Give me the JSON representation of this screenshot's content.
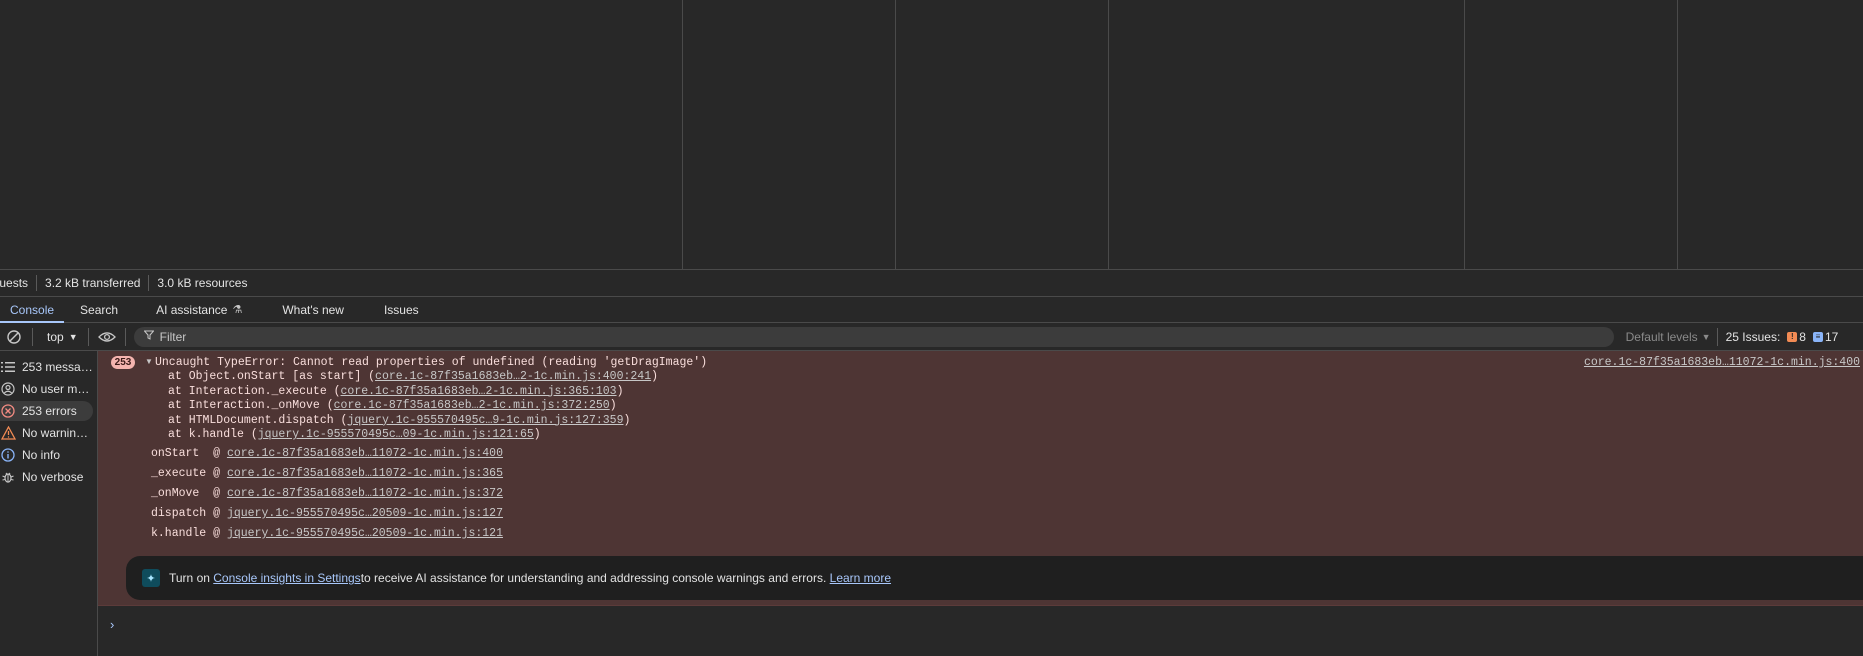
{
  "network_status": {
    "requests": "equests",
    "transferred": "3.2 kB transferred",
    "resources": "3.0 kB resources"
  },
  "drawer_tabs": [
    {
      "label": "Console"
    },
    {
      "label": "Search"
    },
    {
      "label": "AI assistance"
    },
    {
      "label": "What's new"
    },
    {
      "label": "Issues"
    }
  ],
  "toolbar": {
    "context": "top",
    "filter_placeholder": "Filter",
    "levels": "Default levels",
    "issues_label": "25 Issues:",
    "issues_warnings": "8",
    "issues_info": "17"
  },
  "sidebar": {
    "items": [
      {
        "label": "253 messa…"
      },
      {
        "label": "No user m…"
      },
      {
        "label": "253 errors"
      },
      {
        "label": "No warnin…"
      },
      {
        "label": "No info"
      },
      {
        "label": "No verbose"
      }
    ]
  },
  "error": {
    "count": "253",
    "message": "Uncaught TypeError: Cannot read properties of undefined (reading 'getDragImage')",
    "source": "core.1c-87f35a1683eb…11072-1c.min.js:400",
    "stack": [
      {
        "prefix": "at Object.onStart [as start] (",
        "link": "core.1c-87f35a1683eb…2-1c.min.js:400:241",
        "suffix": ")"
      },
      {
        "prefix": "at Interaction._execute (",
        "link": "core.1c-87f35a1683eb…2-1c.min.js:365:103",
        "suffix": ")"
      },
      {
        "prefix": "at Interaction._onMove (",
        "link": "core.1c-87f35a1683eb…2-1c.min.js:372:250",
        "suffix": ")"
      },
      {
        "prefix": "at HTMLDocument.dispatch (",
        "link": "jquery.1c-955570495c…9-1c.min.js:127:359",
        "suffix": ")"
      },
      {
        "prefix": "at k.handle (",
        "link": "jquery.1c-955570495c…09-1c.min.js:121:65",
        "suffix": ")"
      }
    ],
    "frames": [
      {
        "fn": "onStart ",
        "link": "core.1c-87f35a1683eb…11072-1c.min.js:400"
      },
      {
        "fn": "_execute",
        "link": "core.1c-87f35a1683eb…11072-1c.min.js:365"
      },
      {
        "fn": "_onMove ",
        "link": "core.1c-87f35a1683eb…11072-1c.min.js:372"
      },
      {
        "fn": "dispatch",
        "link": "jquery.1c-955570495c…20509-1c.min.js:127"
      },
      {
        "fn": "k.handle",
        "link": "jquery.1c-955570495c…20509-1c.min.js:121"
      }
    ]
  },
  "insight": {
    "pre": "Turn on ",
    "settings_link": "Console insights in Settings",
    "mid": " to receive AI assistance for understanding and addressing console warnings and errors. ",
    "learn_more": "Learn more"
  },
  "colors": {
    "accent": "#a8c7fa",
    "error_bg": "#4e3534",
    "error_badge": "#f4b4af",
    "warning": "#f28b54",
    "info": "#8ab4f8"
  }
}
